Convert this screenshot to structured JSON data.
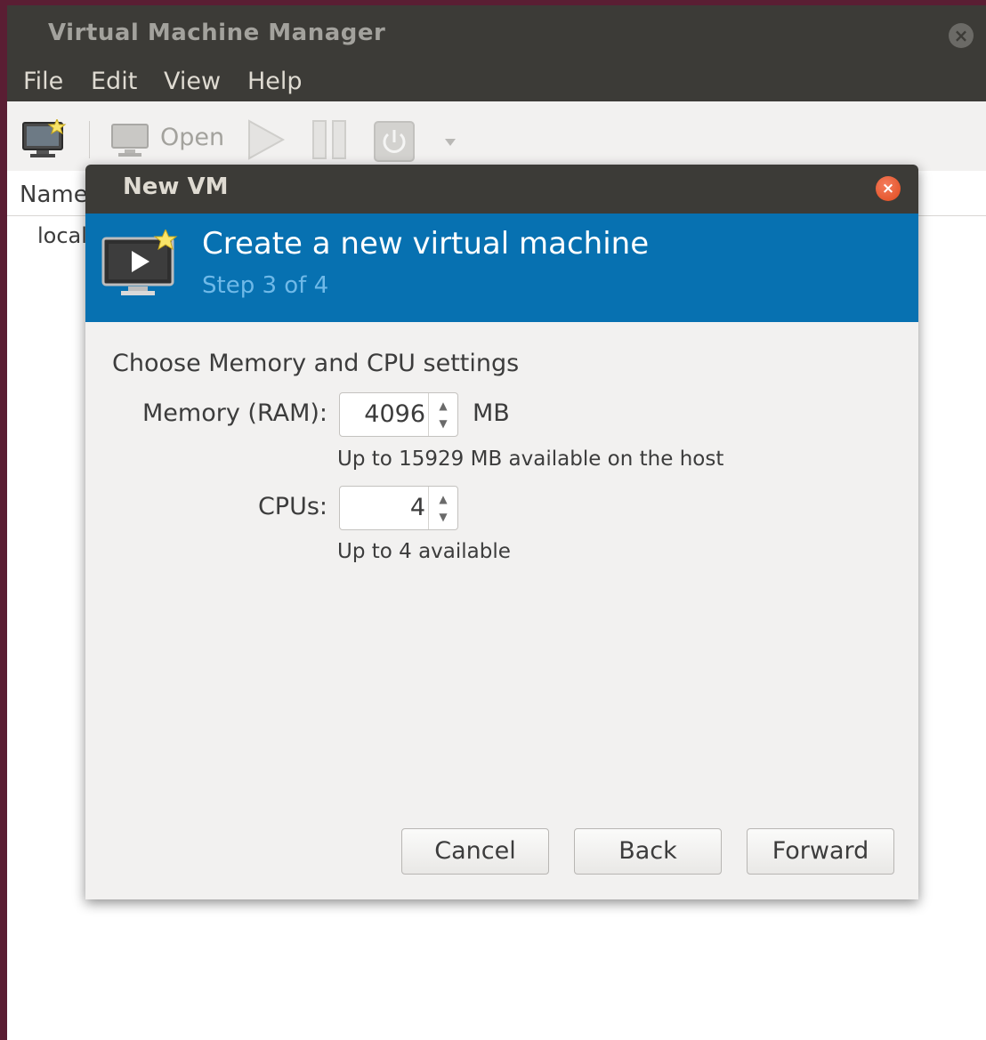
{
  "window": {
    "title": "Virtual Machine Manager"
  },
  "menu": [
    "File",
    "Edit",
    "View",
    "Help"
  ],
  "toolbar": {
    "open_label": "Open"
  },
  "list": {
    "column_name": "Name",
    "items": [
      "localhost"
    ]
  },
  "dialog": {
    "title": "New VM",
    "banner_title": "Create a new virtual machine",
    "step": "Step 3 of 4",
    "section_title": "Choose Memory and CPU settings",
    "memory": {
      "label": "Memory (RAM):",
      "value": "4096",
      "unit": "MB",
      "hint": "Up to 15929 MB available on the host"
    },
    "cpus": {
      "label": "CPUs:",
      "value": "4",
      "hint": "Up to 4 available"
    },
    "buttons": {
      "cancel": "Cancel",
      "back": "Back",
      "forward": "Forward"
    }
  },
  "colors": {
    "titlebar": "#3c3b37",
    "banner": "#0771b1",
    "dialog_bg": "#f2f1f0",
    "close_button": "#df4a1c"
  },
  "icons": {
    "new_vm": "new-vm-icon",
    "open": "monitor-icon",
    "run": "play-icon",
    "pause": "pause-icon",
    "shutdown": "power-icon",
    "menu_arrow": "chevron-down-icon"
  }
}
